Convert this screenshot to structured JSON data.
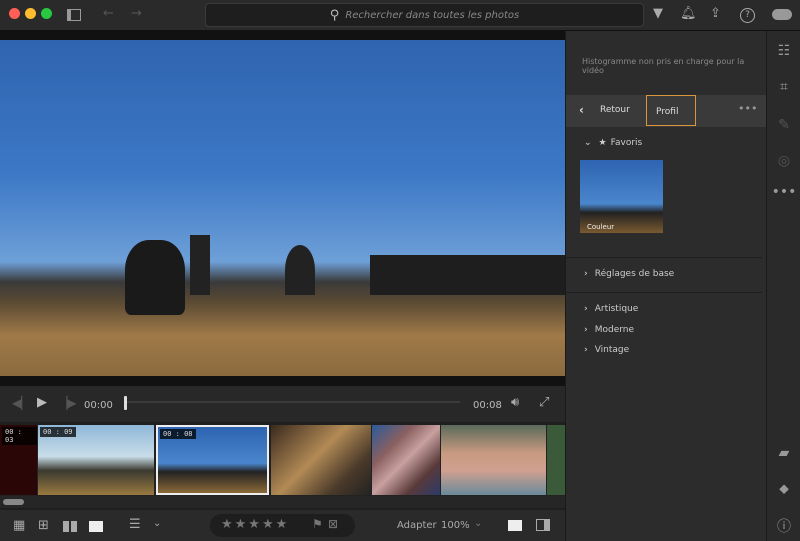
{
  "titlebar": {
    "search_placeholder": "Rechercher dans toutes les photos",
    "traffic_colors": [
      "#ff5f57",
      "#febc2e",
      "#28c840"
    ]
  },
  "player": {
    "current_time": "00:00",
    "duration": "00:08",
    "progress": 0
  },
  "filmstrip": [
    {
      "duration": "00 : 03"
    },
    {
      "duration": "00 : 09"
    },
    {
      "duration": "00 : 08",
      "selected": true
    },
    {},
    {},
    {},
    {}
  ],
  "bottom": {
    "zoom_mode": "Adapter",
    "zoom_value": "100%",
    "rating_stars": 5
  },
  "panel": {
    "histogram_note": "Histogramme non pris en charge pour la vidéo",
    "back_label": "Retour",
    "tab_label": "Profil",
    "favorites_label": "Favoris",
    "favorite_thumb_label": "Couleur",
    "sections": [
      "Réglages de base",
      "Artistique",
      "Moderne",
      "Vintage"
    ],
    "accent": "#d9963a"
  }
}
